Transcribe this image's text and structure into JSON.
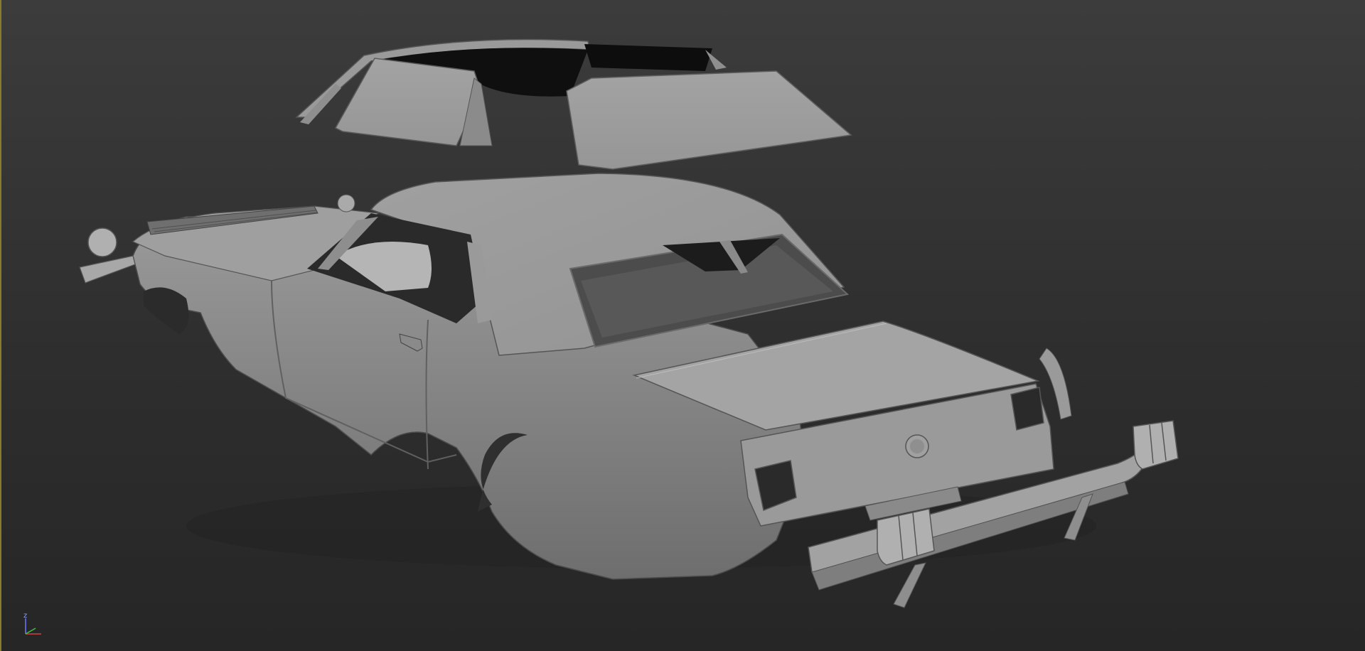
{
  "viewport": {
    "background_top": "#3c3c3c",
    "background_bottom": "#262626",
    "active_border_color": "#8a7a2c"
  },
  "scene": {
    "model_color": "#9c9c9c",
    "shadow_color": "#1a1a1a",
    "highlight_color": "#b4b4b4"
  },
  "axis_gizmo": {
    "z_label": "z",
    "x_color": "#d04040",
    "y_color": "#40c040",
    "z_color": "#6a7cff"
  }
}
